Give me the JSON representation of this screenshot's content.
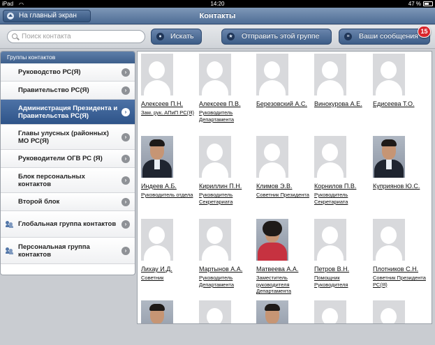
{
  "status": {
    "device": "iPad",
    "time": "14:20",
    "battery": "47 %"
  },
  "nav": {
    "home_label": "На главный экран",
    "title": "Контакты"
  },
  "toolbar": {
    "search_placeholder": "Поиск контакта",
    "search_label": "Искать",
    "send_label": "Отправить этой группе",
    "messages_label": "Ваши сообщения",
    "messages_count": "15"
  },
  "sidebar": {
    "header": "Группы контактов",
    "items": [
      {
        "label": "Руководство РС(Я)"
      },
      {
        "label": "Правительство РС(Я)"
      },
      {
        "label": "Администрация Президента и Правительства РС(Я)",
        "active": true
      },
      {
        "label": "Главы улусных (районных) МО РС(Я)"
      },
      {
        "label": "Руководители ОГВ РС (Я)"
      },
      {
        "label": "Блок персональных контактов"
      },
      {
        "label": "Второй блок"
      },
      {
        "label": "Глобальная группа контактов",
        "icon": "group-icon"
      },
      {
        "label": "Персональная группа контактов",
        "icon": "group-icon"
      }
    ]
  },
  "contacts": [
    {
      "name": "Алексеев П.Н.",
      "position": "Зам. рук. АПиП РС(Я)",
      "photo": "placeholder"
    },
    {
      "name": "Алексеев П.В.",
      "position": "Руководитель Департамента",
      "photo": "placeholder"
    },
    {
      "name": "Березовский А.С.",
      "position": "",
      "photo": "placeholder"
    },
    {
      "name": "Винокурова А.Е.",
      "position": "",
      "photo": "placeholder"
    },
    {
      "name": "Едисеева Т.О.",
      "position": "",
      "photo": "placeholder"
    },
    {
      "name": "Индеев А.Б.",
      "position": "Руководитель отдела",
      "photo": "real-male"
    },
    {
      "name": "Кириллин П.Н.",
      "position": "Руководитель Секретариата",
      "photo": "placeholder"
    },
    {
      "name": "Климов Э.В.",
      "position": "Советник Президента",
      "photo": "placeholder"
    },
    {
      "name": "Корнилов П.В.",
      "position": "Руководитель Секретариата",
      "photo": "placeholder"
    },
    {
      "name": "Куприянов Ю.С.",
      "position": "",
      "photo": "real-male"
    },
    {
      "name": "Лихау И.Д.",
      "position": "Советник",
      "photo": "placeholder"
    },
    {
      "name": "Мартынов А.А.",
      "position": "Руководитель Департамента",
      "photo": "placeholder"
    },
    {
      "name": "Матвеева А.А.",
      "position": "Заместитель руководителя Департамента",
      "photo": "real-female"
    },
    {
      "name": "Петров В.Н.",
      "position": "Помощник Руководителя",
      "photo": "placeholder"
    },
    {
      "name": "Плотников С.Н.",
      "position": "Советник Президента РС(Я)",
      "photo": "placeholder"
    },
    {
      "name": "",
      "position": "",
      "photo": "real-male"
    },
    {
      "name": "",
      "position": "",
      "photo": "placeholder"
    },
    {
      "name": "",
      "position": "",
      "photo": "real-male"
    },
    {
      "name": "",
      "position": "",
      "photo": "placeholder"
    },
    {
      "name": "",
      "position": "",
      "photo": "placeholder"
    }
  ]
}
